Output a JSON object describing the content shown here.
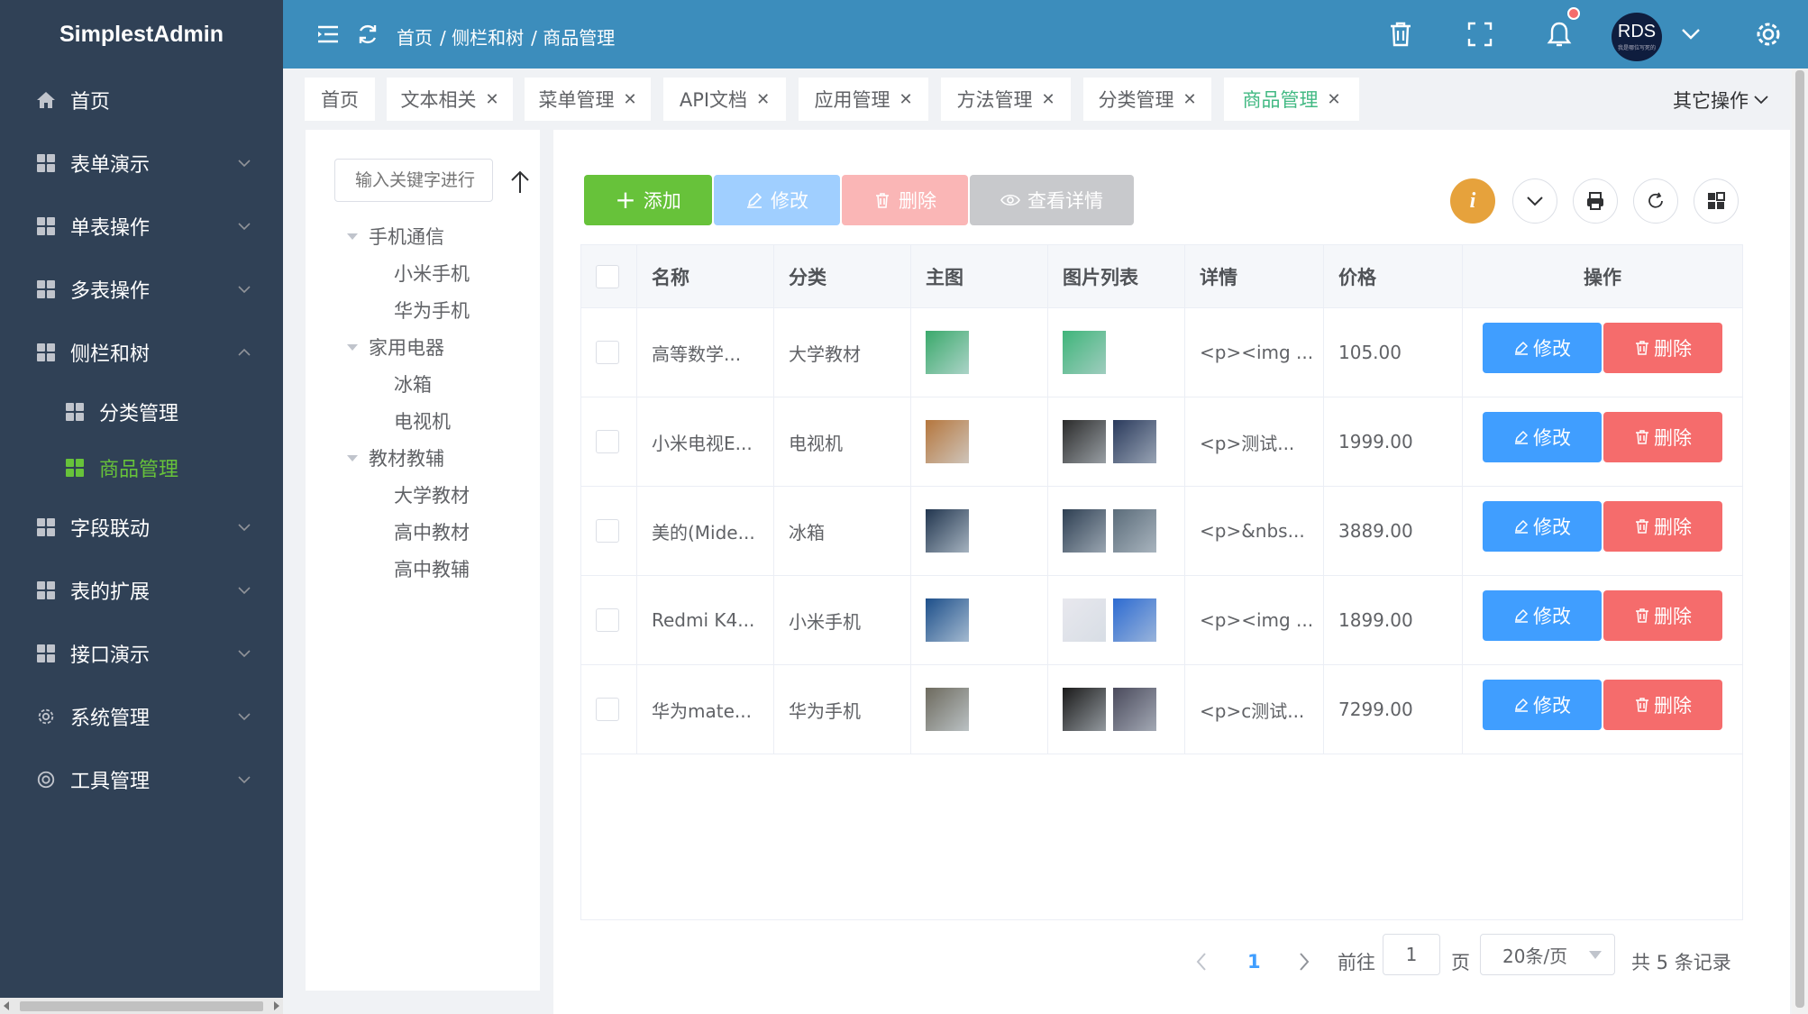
{
  "app": {
    "title": "SimplestAdmin"
  },
  "sidebar": {
    "items": [
      {
        "label": "首页",
        "icon": "home-icon"
      },
      {
        "label": "表单演示",
        "icon": "grid-icon"
      },
      {
        "label": "单表操作",
        "icon": "grid-icon"
      },
      {
        "label": "多表操作",
        "icon": "grid-icon"
      },
      {
        "label": "侧栏和树",
        "icon": "grid-icon",
        "expanded": true
      },
      {
        "label": "分类管理",
        "icon": "grid-icon"
      },
      {
        "label": "商品管理",
        "icon": "grid-icon",
        "active": true
      },
      {
        "label": "字段联动",
        "icon": "grid-icon"
      },
      {
        "label": "表的扩展",
        "icon": "grid-icon"
      },
      {
        "label": "接口演示",
        "icon": "grid-icon"
      },
      {
        "label": "系统管理",
        "icon": "gear-icon"
      },
      {
        "label": "工具管理",
        "icon": "lifebuoy-icon"
      }
    ]
  },
  "header": {
    "breadcrumb": [
      "首页",
      "/ 侧栏和树",
      "/ 商品管理"
    ],
    "avatar_text": "RDS",
    "avatar_sub": "我是哪位写死的"
  },
  "tabs": [
    {
      "label": "首页",
      "closable": false
    },
    {
      "label": "文本相关",
      "closable": true
    },
    {
      "label": "菜单管理",
      "closable": true
    },
    {
      "label": "API文档",
      "closable": true
    },
    {
      "label": "应用管理",
      "closable": true
    },
    {
      "label": "方法管理",
      "closable": true
    },
    {
      "label": "分类管理",
      "closable": true
    },
    {
      "label": "商品管理",
      "closable": true,
      "active": true
    }
  ],
  "other_ops": "其它操作",
  "tree": {
    "search_placeholder": "输入关键字进行",
    "nodes": [
      {
        "label": "手机通信",
        "level": 0
      },
      {
        "label": "小米手机",
        "level": 1
      },
      {
        "label": "华为手机",
        "level": 1
      },
      {
        "label": "家用电器",
        "level": 0
      },
      {
        "label": "冰箱",
        "level": 1
      },
      {
        "label": "电视机",
        "level": 1
      },
      {
        "label": "教材教辅",
        "level": 0
      },
      {
        "label": "大学教材",
        "level": 1
      },
      {
        "label": "高中教材",
        "level": 1
      },
      {
        "label": "高中教辅",
        "level": 1
      }
    ]
  },
  "toolbar": {
    "add": "添加",
    "edit": "修改",
    "delete": "删除",
    "detail": "查看详情"
  },
  "table": {
    "headers": [
      "名称",
      "分类",
      "主图",
      "图片列表",
      "详情",
      "价格",
      "操作"
    ],
    "rows": [
      {
        "name": "高等数学...",
        "category": "大学教材",
        "detail": "<p><img ...",
        "price": "105.00",
        "main_color": "#3aa96b",
        "list_colors": [
          "#3fb57a"
        ]
      },
      {
        "name": "小米电视E...",
        "category": "电视机",
        "detail": "<p>测试...",
        "price": "1999.00",
        "main_color": "#b5763d",
        "list_colors": [
          "#2b2b2b",
          "#2a3a5c"
        ]
      },
      {
        "name": "美的(Mide...",
        "category": "冰箱",
        "detail": "<p>&nbs...",
        "price": "3889.00",
        "main_color": "#22364f",
        "list_colors": [
          "#2e3f52",
          "#5b6c7a"
        ]
      },
      {
        "name": "Redmi K4...",
        "category": "小米手机",
        "detail": "<p><img ...",
        "price": "1899.00",
        "main_color": "#1d4f8a",
        "list_colors": [
          "#e8e8ee",
          "#2d6bd1"
        ]
      },
      {
        "name": "华为mate...",
        "category": "华为手机",
        "detail": "<p>c测试...",
        "price": "7299.00",
        "main_color": "#6d6a5e",
        "list_colors": [
          "#1a1a1a",
          "#4a4a5c"
        ]
      }
    ],
    "row_edit": "修改",
    "row_delete": "删除"
  },
  "pagination": {
    "current_page": "1",
    "goto_label": "前往",
    "goto_value": "1",
    "page_unit": "页",
    "page_size": "20条/页",
    "total": "共 5 条记录"
  },
  "colors": {
    "sidebar_bg": "#304156",
    "header_bg": "#3c8dbc",
    "active_green": "#67c23a",
    "tab_active": "#42b983",
    "primary": "#409eff",
    "danger": "#f56c6c",
    "warning": "#e6a23c"
  }
}
